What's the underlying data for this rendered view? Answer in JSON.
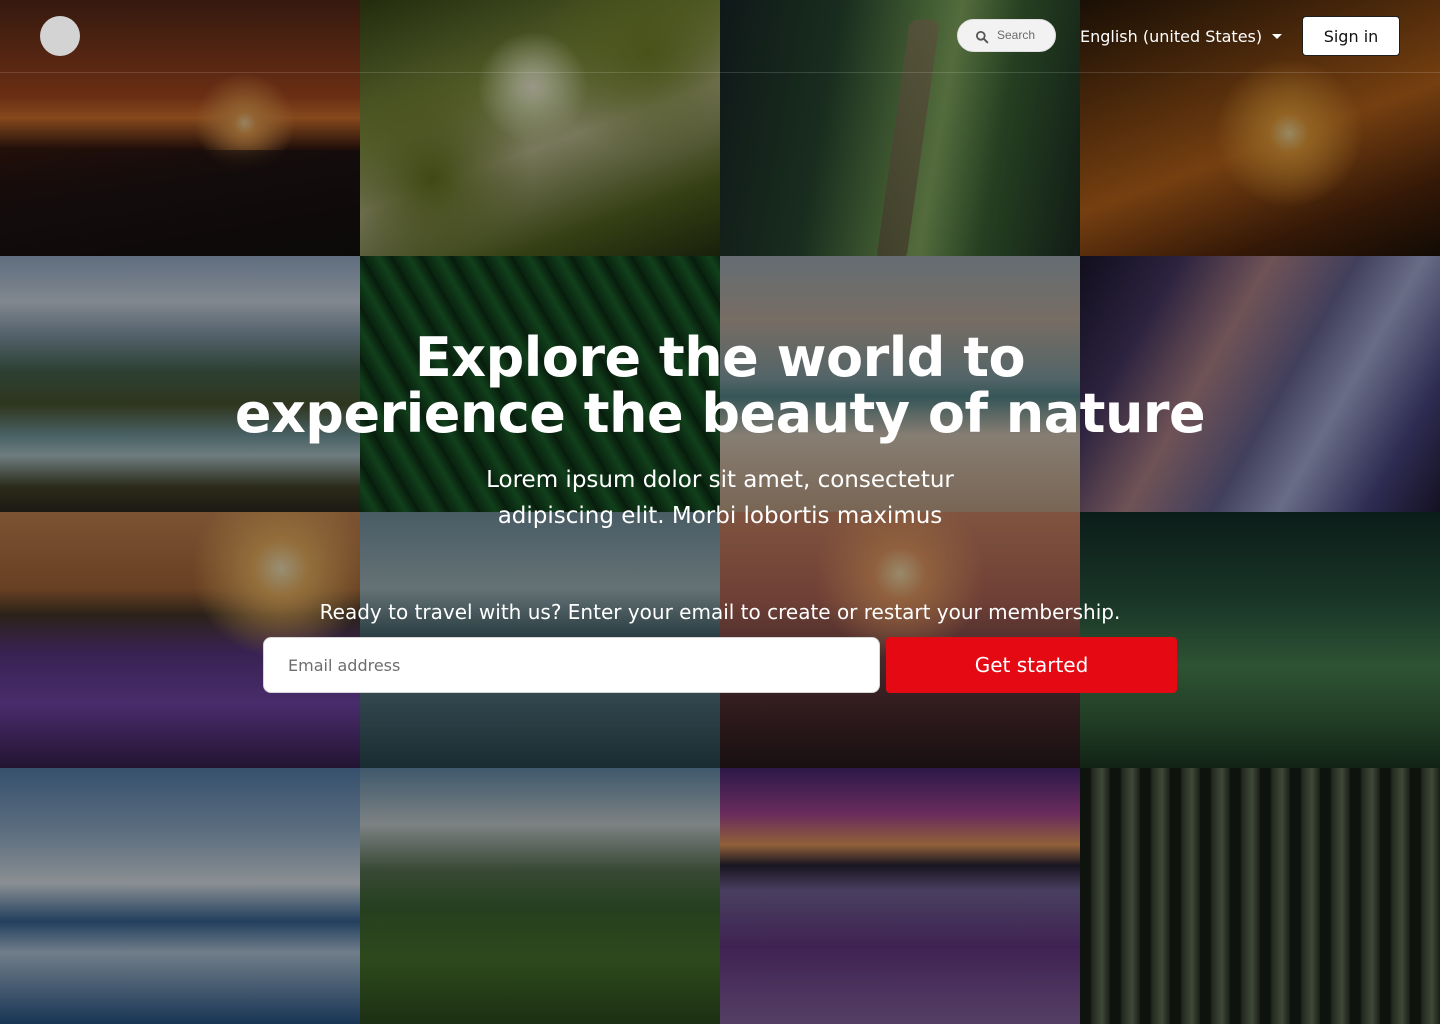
{
  "header": {
    "search_placeholder": "Search",
    "language_label": "English (united States)",
    "signin_label": "Sign in"
  },
  "hero": {
    "title_line1": "Explore the world to",
    "title_line2": "experience the beauty of nature",
    "subtitle_line1": "Lorem ipsum dolor sit amet, consectetur",
    "subtitle_line2": "adipiscing elit. Morbi lobortis maximus"
  },
  "signup": {
    "prompt": "Ready to travel with us? Enter your email to create or restart your membership.",
    "email_placeholder": "Email address",
    "cta_label": "Get started"
  },
  "colors": {
    "cta": "#e50914",
    "overlay": "rgba(0,0,0,0.40)",
    "text": "#ffffff"
  },
  "icons": {
    "search": "search-icon",
    "language_dropdown": "caret-down-icon"
  }
}
